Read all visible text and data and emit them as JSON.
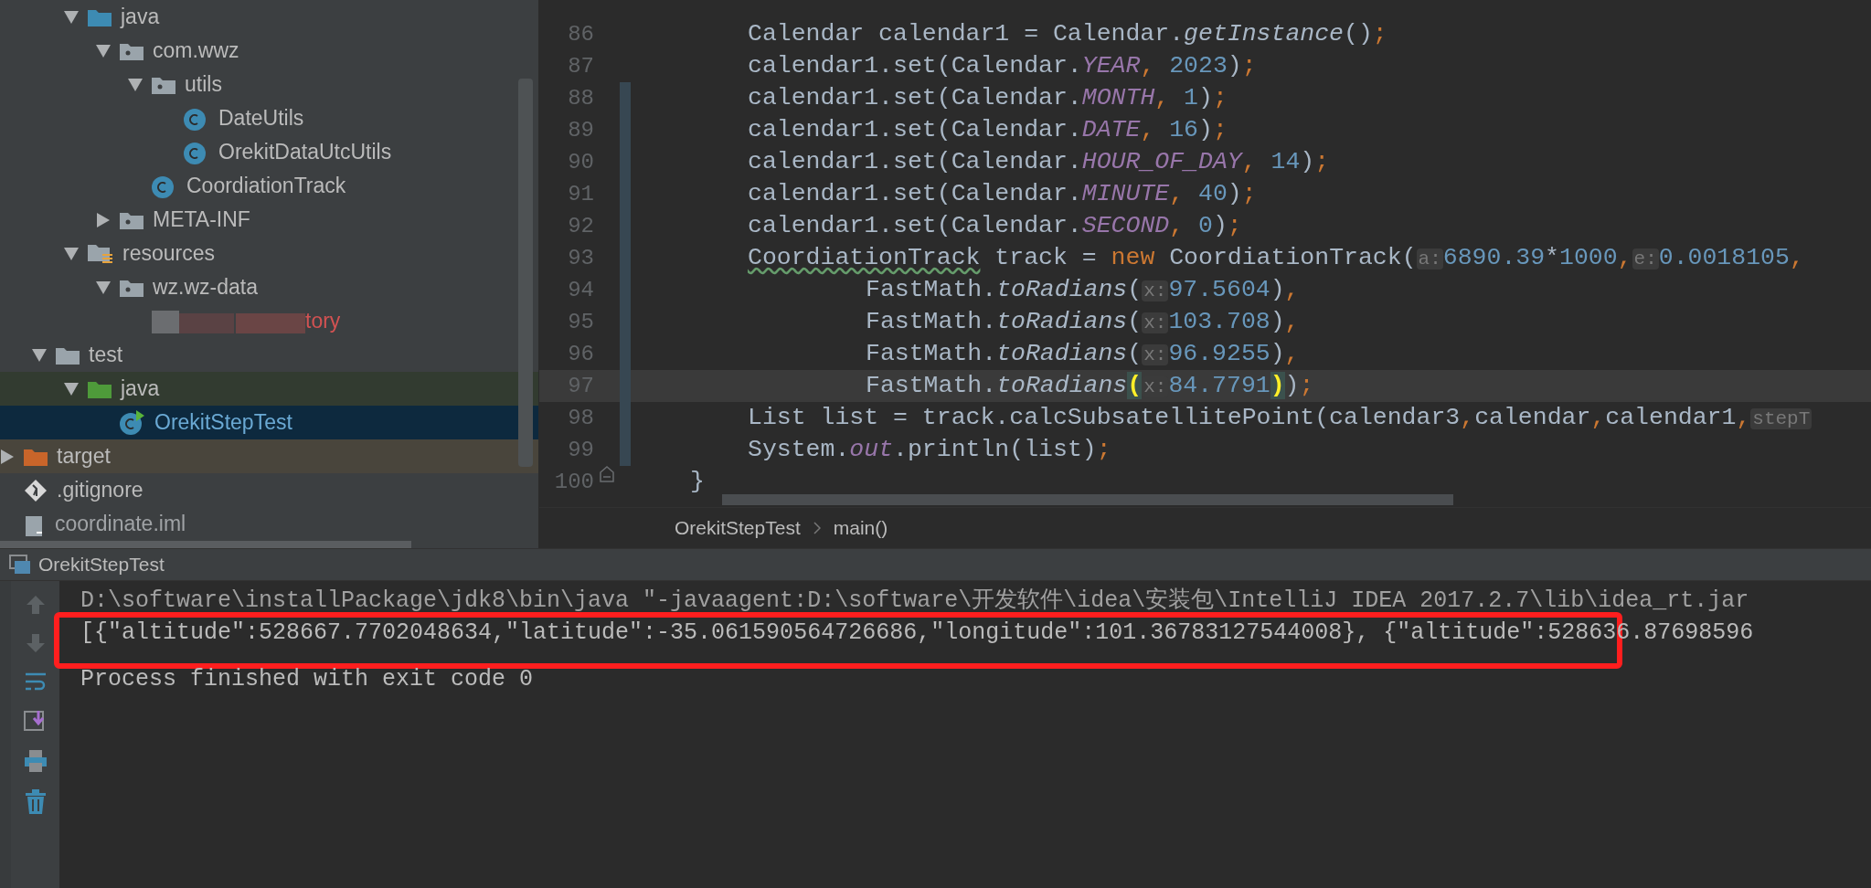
{
  "project_tree": [
    {
      "children": [
        {
          "children": [
            {
              "label": "java",
              "kind": "source-folder",
              "expanded": true,
              "selected": false,
              "children": [
                {
                  "label": "com.wwz",
                  "kind": "package",
                  "expanded": true,
                  "selected": false,
                  "children": [
                    {
                      "label": "utils",
                      "kind": "package",
                      "expanded": true,
                      "selected": false,
                      "children": [
                        {
                          "label": "DateUtils",
                          "kind": "class",
                          "selected": false
                        },
                        {
                          "label": "OrekitDataUtcUtils",
                          "kind": "class",
                          "selected": false
                        }
                      ]
                    },
                    {
                      "label": "CoordiationTrack",
                      "kind": "class",
                      "selected": false
                    }
                  ]
                },
                {
                  "label": "META-INF",
                  "kind": "package",
                  "expanded": false,
                  "selected": false
                }
              ]
            },
            {
              "label": "resources",
              "kind": "resources-folder",
              "expanded": true,
              "selected": false,
              "children": [
                {
                  "label": "wz.wz-data",
                  "kind": "package",
                  "expanded": true,
                  "selected": false,
                  "children": [
                    {
                      "label": "tory",
                      "kind": "redacted-file",
                      "selected": false
                    }
                  ]
                }
              ]
            }
          ]
        },
        {
          "label": "test",
          "kind": "folder",
          "expanded": true,
          "selected": false,
          "children": [
            {
              "label": "java",
              "kind": "test-folder",
              "expanded": true,
              "selected": false,
              "children": [
                {
                  "label": "OrekitStepTest",
                  "kind": "test-class",
                  "selected": true
                }
              ]
            }
          ]
        }
      ]
    },
    {
      "label": "target",
      "kind": "excluded-folder",
      "expanded": false,
      "selected": false
    },
    {
      "label": ".gitignore",
      "kind": "git-file",
      "selected": false
    },
    {
      "label": "coordinate.iml",
      "kind": "module-file",
      "selected": false
    }
  ],
  "editor": {
    "lines": [
      {
        "number": "86",
        "kind": "statement",
        "changed": false,
        "current": false,
        "fold": false,
        "tokens": [
          {
            "kind": "plain",
            "text": "Calendar calendar1 = Calendar."
          },
          {
            "kind": "method",
            "text": "getInstance"
          },
          {
            "kind": "plain",
            "text": "()"
          },
          {
            "kind": "punct",
            "text": ";"
          }
        ]
      },
      {
        "number": "87",
        "kind": "statement",
        "changed": false,
        "current": false,
        "fold": false,
        "tokens": [
          {
            "kind": "plain",
            "text": "calendar1.set(Calendar."
          },
          {
            "kind": "field",
            "text": "YEAR"
          },
          {
            "kind": "punct",
            "text": ", "
          },
          {
            "kind": "number",
            "text": "2023"
          },
          {
            "kind": "plain",
            "text": ")"
          },
          {
            "kind": "punct",
            "text": ";"
          }
        ]
      },
      {
        "number": "88",
        "kind": "statement",
        "changed": true,
        "current": false,
        "fold": false,
        "tokens": [
          {
            "kind": "plain",
            "text": "calendar1.set(Calendar."
          },
          {
            "kind": "field",
            "text": "MONTH"
          },
          {
            "kind": "punct",
            "text": ", "
          },
          {
            "kind": "number",
            "text": "1"
          },
          {
            "kind": "plain",
            "text": ")"
          },
          {
            "kind": "punct",
            "text": ";"
          }
        ]
      },
      {
        "number": "89",
        "kind": "statement",
        "changed": true,
        "current": false,
        "fold": false,
        "tokens": [
          {
            "kind": "plain",
            "text": "calendar1.set(Calendar."
          },
          {
            "kind": "field",
            "text": "DATE"
          },
          {
            "kind": "punct",
            "text": ", "
          },
          {
            "kind": "number",
            "text": "16"
          },
          {
            "kind": "plain",
            "text": ")"
          },
          {
            "kind": "punct",
            "text": ";"
          }
        ]
      },
      {
        "number": "90",
        "kind": "statement",
        "changed": true,
        "current": false,
        "fold": false,
        "tokens": [
          {
            "kind": "plain",
            "text": "calendar1.set(Calendar."
          },
          {
            "kind": "field",
            "text": "HOUR_OF_DAY"
          },
          {
            "kind": "punct",
            "text": ", "
          },
          {
            "kind": "number",
            "text": "14"
          },
          {
            "kind": "plain",
            "text": ")"
          },
          {
            "kind": "punct",
            "text": ";"
          }
        ]
      },
      {
        "number": "91",
        "kind": "statement",
        "changed": true,
        "current": false,
        "fold": false,
        "tokens": [
          {
            "kind": "plain",
            "text": "calendar1.set(Calendar."
          },
          {
            "kind": "field",
            "text": "MINUTE"
          },
          {
            "kind": "punct",
            "text": ", "
          },
          {
            "kind": "number",
            "text": "40"
          },
          {
            "kind": "plain",
            "text": ")"
          },
          {
            "kind": "punct",
            "text": ";"
          }
        ]
      },
      {
        "number": "92",
        "kind": "statement",
        "changed": true,
        "current": false,
        "fold": false,
        "tokens": [
          {
            "kind": "plain",
            "text": "calendar1.set(Calendar."
          },
          {
            "kind": "field",
            "text": "SECOND"
          },
          {
            "kind": "punct",
            "text": ", "
          },
          {
            "kind": "number",
            "text": "0"
          },
          {
            "kind": "plain",
            "text": ")"
          },
          {
            "kind": "punct",
            "text": ";"
          }
        ]
      },
      {
        "number": "93",
        "kind": "statement",
        "changed": true,
        "current": false,
        "fold": false,
        "tokens": [
          {
            "kind": "typo",
            "text": "CoordiationTrack"
          },
          {
            "kind": "plain",
            "text": " track = "
          },
          {
            "kind": "keyword",
            "text": "new"
          },
          {
            "kind": "plain",
            "text": " CoordiationTrack("
          },
          {
            "kind": "hint",
            "text": "a:"
          },
          {
            "kind": "number",
            "text": "6890.39"
          },
          {
            "kind": "plain",
            "text": "*"
          },
          {
            "kind": "number",
            "text": "1000"
          },
          {
            "kind": "punct",
            "text": ","
          },
          {
            "kind": "hint",
            "text": "e:"
          },
          {
            "kind": "number",
            "text": "0.0018105"
          },
          {
            "kind": "punct",
            "text": ","
          }
        ]
      },
      {
        "number": "94",
        "kind": "continuation",
        "changed": true,
        "current": false,
        "fold": false,
        "tokens": [
          {
            "kind": "plain",
            "text": "FastMath."
          },
          {
            "kind": "method",
            "text": "toRadians"
          },
          {
            "kind": "plain",
            "text": "("
          },
          {
            "kind": "hint",
            "text": "x:"
          },
          {
            "kind": "number",
            "text": "97.5604"
          },
          {
            "kind": "plain",
            "text": ")"
          },
          {
            "kind": "punct",
            "text": ","
          }
        ]
      },
      {
        "number": "95",
        "kind": "continuation",
        "changed": true,
        "current": false,
        "fold": false,
        "tokens": [
          {
            "kind": "plain",
            "text": "FastMath."
          },
          {
            "kind": "method",
            "text": "toRadians"
          },
          {
            "kind": "plain",
            "text": "("
          },
          {
            "kind": "hint",
            "text": "x:"
          },
          {
            "kind": "number",
            "text": "103.708"
          },
          {
            "kind": "plain",
            "text": ")"
          },
          {
            "kind": "punct",
            "text": ","
          }
        ]
      },
      {
        "number": "96",
        "kind": "continuation",
        "changed": true,
        "current": false,
        "fold": false,
        "tokens": [
          {
            "kind": "plain",
            "text": "FastMath."
          },
          {
            "kind": "method",
            "text": "toRadians"
          },
          {
            "kind": "plain",
            "text": "("
          },
          {
            "kind": "hint",
            "text": "x:"
          },
          {
            "kind": "number",
            "text": "96.9255"
          },
          {
            "kind": "plain",
            "text": ")"
          },
          {
            "kind": "punct",
            "text": ","
          }
        ]
      },
      {
        "number": "97",
        "kind": "continuation",
        "changed": true,
        "current": true,
        "fold": false,
        "tokens": [
          {
            "kind": "plain",
            "text": "FastMath."
          },
          {
            "kind": "method",
            "text": "toRadians"
          },
          {
            "kind": "brace-match",
            "text": "("
          },
          {
            "kind": "hint",
            "text": "x:"
          },
          {
            "kind": "number",
            "text": "84.7791"
          },
          {
            "kind": "brace-match",
            "text": ")"
          },
          {
            "kind": "plain",
            "text": ")"
          },
          {
            "kind": "punct",
            "text": ";"
          }
        ]
      },
      {
        "number": "98",
        "kind": "statement",
        "changed": true,
        "current": false,
        "fold": false,
        "tokens": [
          {
            "kind": "plain",
            "text": "List list = track.calcSubsatellitePoint(calendar3"
          },
          {
            "kind": "punct",
            "text": ","
          },
          {
            "kind": "plain",
            "text": "calendar"
          },
          {
            "kind": "punct",
            "text": ","
          },
          {
            "kind": "plain",
            "text": "calendar1"
          },
          {
            "kind": "punct",
            "text": ","
          },
          {
            "kind": "hint",
            "text": "stepT"
          }
        ]
      },
      {
        "number": "99",
        "kind": "statement",
        "changed": true,
        "current": false,
        "fold": false,
        "tokens": [
          {
            "kind": "plain",
            "text": "System."
          },
          {
            "kind": "field",
            "text": "out"
          },
          {
            "kind": "plain",
            "text": ".println(list)"
          },
          {
            "kind": "punct",
            "text": ";"
          }
        ]
      },
      {
        "number": "100",
        "kind": "close",
        "changed": false,
        "current": false,
        "fold": true,
        "tokens": [
          {
            "kind": "plain",
            "text": "}"
          }
        ]
      }
    ],
    "breadcrumbs": [
      "OrekitStepTest",
      "main()"
    ]
  },
  "run_panel": {
    "tab": "OrekitStepTest",
    "lines": [
      {
        "kind": "command",
        "text": "D:\\software\\installPackage\\jdk8\\bin\\java \"-javaagent:D:\\software\\开发软件\\idea\\安装包\\IntelliJ IDEA 2017.2.7\\lib\\idea_rt.jar"
      },
      {
        "kind": "output",
        "text": "[{\"altitude\":528667.7702048634,\"latitude\":-35.061590564726686,\"longitude\":101.36783127544008}, {\"altitude\":528636.87698596"
      },
      {
        "kind": "exit",
        "text": "Process finished with exit code 0"
      }
    ]
  }
}
